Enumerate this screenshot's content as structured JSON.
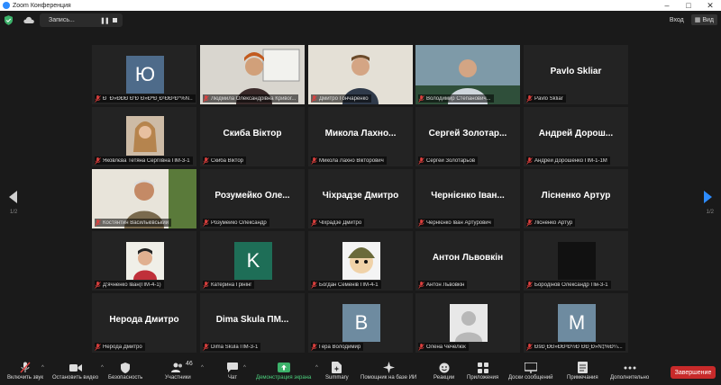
{
  "window": {
    "title": "Zoom Конференция"
  },
  "topbar": {
    "recording_label": "Запись...",
    "enter_label": "Вход",
    "view_label": "Вид"
  },
  "pagination": {
    "left": "1/2",
    "right": "1/2"
  },
  "tiles": [
    {
      "name": "Ю",
      "caption": "Ð¯Ð»ÐÐÐ Ð‘Ð´Ð»ÐºÐ¸Ð¹ÐÐ²Ð°%Ñ…",
      "kind": "letter",
      "bg": "#4e6b8a"
    },
    {
      "name": "",
      "caption": "Людмила Олександрівна Кривог...",
      "kind": "photo"
    },
    {
      "name": "",
      "caption": "Дмитро Гончаренко",
      "kind": "photo"
    },
    {
      "name": "",
      "caption": "Володимир Степанович...",
      "kind": "photo",
      "active": true
    },
    {
      "name": "Pavlo Skliar",
      "caption": "Pavlo Skliar",
      "kind": "name"
    },
    {
      "name": "",
      "caption": "Яковлєва Тетяна Сергіївна ПМ-3-1",
      "kind": "photo"
    },
    {
      "name": "Скиба Віктор",
      "caption": "Скиба Віктор",
      "kind": "name"
    },
    {
      "name": "Микола  Лахно...",
      "caption": "Микола Лахно Вікторович",
      "kind": "name"
    },
    {
      "name": "Сергей  Золотар...",
      "caption": "Сергей Золотарьов",
      "kind": "name"
    },
    {
      "name": "Андрей  Дорош...",
      "caption": "Андрей Дорошенко ПМ-1-1М",
      "kind": "name"
    },
    {
      "name": "",
      "caption": "Костянтин Васильківський",
      "kind": "photo"
    },
    {
      "name": "Розумейко  Оле...",
      "caption": "Розумейко Олександр",
      "kind": "name"
    },
    {
      "name": "Чіхрадзе Дмитро",
      "caption": "Чіхрадзе Дмитро",
      "kind": "name"
    },
    {
      "name": "Чернієнко  Іван...",
      "caption": "Чернієнко Іван Артурович",
      "kind": "name"
    },
    {
      "name": "Лісненко Артур",
      "caption": "Лісненко Артур",
      "kind": "name"
    },
    {
      "name": "",
      "caption": "Д'ячненко Іван(ПМ-4-1)",
      "kind": "photo"
    },
    {
      "name": "K",
      "caption": "Катерина Грінінг",
      "kind": "letter",
      "bg": "#1e6e57"
    },
    {
      "name": "",
      "caption": "Богдан Семенів ПМ-4-1",
      "kind": "photo"
    },
    {
      "name": "Антон Львовкін",
      "caption": "Антон Львовкін",
      "kind": "name"
    },
    {
      "name": "",
      "caption": "Бородінов Олександр Пм-3-1",
      "kind": "dark"
    },
    {
      "name": "Нерода Дмитро",
      "caption": "Нерода Дмитро",
      "kind": "name"
    },
    {
      "name": "Dima  Skula  ПМ...",
      "caption": "Dima Skula ПМ-3-1",
      "kind": "name"
    },
    {
      "name": "B",
      "caption": "Гера Володимир",
      "kind": "letter",
      "bg": "#6e8ba0"
    },
    {
      "name": "",
      "caption": "Олена Чечелюк",
      "kind": "silhouette"
    },
    {
      "name": "M",
      "caption": "ÐšÐ¸ÐÐ»ÐÐ²Ð½Ð´ÐÐ¸Ð»Ñ‡%Ð¼...",
      "kind": "letter",
      "bg": "#6e8ba0"
    }
  ],
  "toolbar": {
    "unmute": "Включить звук",
    "video": "Остановить видео",
    "security": "Безопасность",
    "participants": "Участники",
    "participants_count": "46",
    "chat": "Чат",
    "share": "Демонстрация экрана",
    "summary": "Summary",
    "ai": "Помощник на базе ИИ",
    "reactions": "Реакции",
    "apps": "Приложения",
    "whiteboards": "Доски сообщений",
    "notes": "Примечания",
    "more": "Дополнительно",
    "end": "Завершение"
  },
  "colors": {
    "active_speaker": "#9ccc3c",
    "end_button": "#c82a2a",
    "share_green": "#4cd07d"
  }
}
